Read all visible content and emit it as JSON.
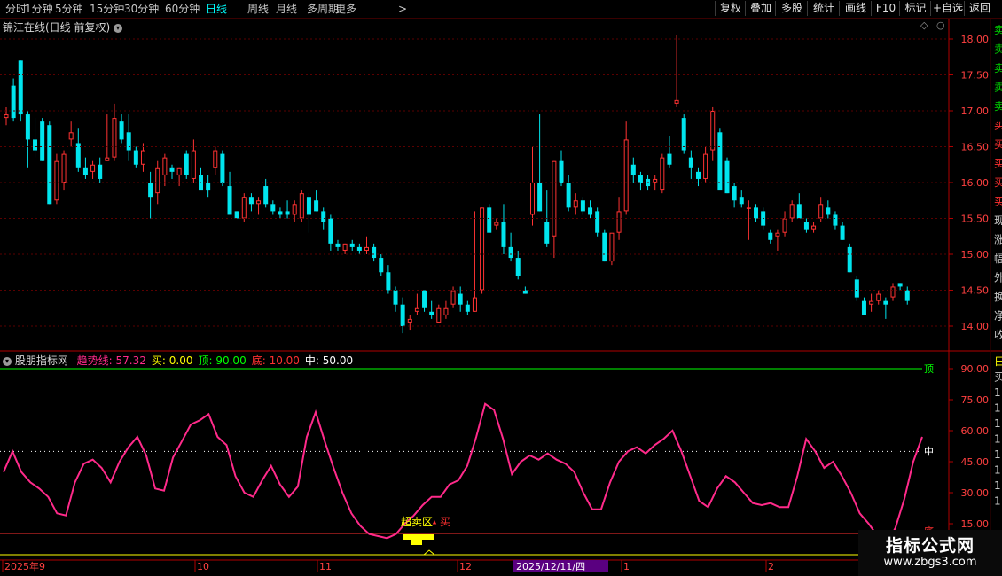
{
  "toolbar": {
    "periods": [
      {
        "label": "分时",
        "active": false
      },
      {
        "label": "1分钟",
        "active": false
      },
      {
        "label": "5分钟",
        "active": false
      },
      {
        "label": "15分钟",
        "active": false
      },
      {
        "label": "30分钟",
        "active": false
      },
      {
        "label": "60分钟",
        "active": false
      },
      {
        "label": "日线",
        "active": true
      },
      {
        "label": "周线",
        "active": false
      },
      {
        "label": "月线",
        "active": false
      },
      {
        "label": "多周期",
        "active": false
      },
      {
        "label": "更多",
        "active": false
      }
    ],
    "more_arrow": ">",
    "right_buttons": [
      "复权",
      "叠加",
      "多股",
      "统计",
      "画线",
      "F10",
      "标记",
      "+自选",
      "返回"
    ]
  },
  "price_panel": {
    "title": "锦江在线(日线 前复权)",
    "axis_ticks": [
      "18.00",
      "17.50",
      "17.00",
      "16.50",
      "16.00",
      "15.50",
      "15.00",
      "14.50",
      "14.00"
    ],
    "right_strip_chars": [
      "卖",
      "卖",
      "卖",
      "卖",
      "卖",
      "买",
      "买",
      "买",
      "买",
      "买",
      "现",
      "涨",
      "幅",
      "外",
      "换",
      "净",
      "收"
    ]
  },
  "indicator_panel": {
    "name": "股朋指标网",
    "legend": [
      {
        "label": "趋势线:",
        "value": "57.32",
        "color": "#ff2a8a"
      },
      {
        "label": "买:",
        "value": "0.00",
        "color": "#ffff00"
      },
      {
        "label": "顶:",
        "value": "90.00",
        "color": "#00ff00"
      },
      {
        "label": "底:",
        "value": "10.00",
        "color": "#ff3030"
      },
      {
        "label": "中:",
        "value": "50.00",
        "color": "#ffffff"
      }
    ],
    "axis_ticks": [
      "90.00",
      "75.00",
      "60.00",
      "45.00",
      "30.00",
      "15.00"
    ],
    "label_top": "顶",
    "label_mid": "中",
    "label_bottom": "底",
    "annotation_oversold": "超卖区",
    "annotation_buy": "买",
    "right_strip_chars": [
      "日",
      "买",
      "1",
      "1",
      "1",
      "1",
      "1",
      "1",
      "1",
      "1"
    ]
  },
  "date_axis": {
    "labels": [
      "2025年9",
      "10",
      "11",
      "12",
      "1",
      "2"
    ],
    "highlight": "2025/12/11/四"
  },
  "watermark": {
    "title": "指标公式网",
    "url": "www.zbgs3.com"
  },
  "colors": {
    "up": "#ff3232",
    "down": "#00e5ee",
    "trend": "#ff2a8a",
    "top": "#00ff00",
    "bottom": "#ff3030",
    "buy": "#ffff00",
    "mid": "#ffffff",
    "axis": "#b00000"
  },
  "chart_data": {
    "type": "candlestick",
    "price_range": [
      13.85,
      18.1
    ],
    "candles": [
      {
        "o": 16.9,
        "h": 17.05,
        "l": 16.8,
        "c": 16.95
      },
      {
        "o": 17.35,
        "h": 17.45,
        "l": 16.85,
        "c": 16.9
      },
      {
        "o": 17.7,
        "h": 17.7,
        "l": 16.85,
        "c": 16.95
      },
      {
        "o": 16.95,
        "h": 17.0,
        "l": 16.2,
        "c": 16.6
      },
      {
        "o": 16.6,
        "h": 16.9,
        "l": 16.35,
        "c": 16.45
      },
      {
        "o": 16.85,
        "h": 16.9,
        "l": 16.3,
        "c": 16.3
      },
      {
        "o": 16.8,
        "h": 16.85,
        "l": 15.7,
        "c": 15.7
      },
      {
        "o": 15.75,
        "h": 16.4,
        "l": 15.7,
        "c": 16.3
      },
      {
        "o": 16.0,
        "h": 16.45,
        "l": 15.9,
        "c": 16.4
      },
      {
        "o": 16.6,
        "h": 16.85,
        "l": 16.5,
        "c": 16.7
      },
      {
        "o": 16.55,
        "h": 16.75,
        "l": 16.15,
        "c": 16.2
      },
      {
        "o": 16.2,
        "h": 16.35,
        "l": 16.05,
        "c": 16.1
      },
      {
        "o": 16.15,
        "h": 16.3,
        "l": 16.05,
        "c": 16.25
      },
      {
        "o": 16.25,
        "h": 16.35,
        "l": 16.0,
        "c": 16.05
      },
      {
        "o": 16.3,
        "h": 16.95,
        "l": 16.3,
        "c": 16.35
      },
      {
        "o": 16.35,
        "h": 17.1,
        "l": 16.3,
        "c": 16.9
      },
      {
        "o": 16.85,
        "h": 16.95,
        "l": 16.55,
        "c": 16.6
      },
      {
        "o": 16.7,
        "h": 16.95,
        "l": 16.3,
        "c": 16.45
      },
      {
        "o": 16.45,
        "h": 16.5,
        "l": 16.2,
        "c": 16.25
      },
      {
        "o": 16.25,
        "h": 16.55,
        "l": 16.15,
        "c": 16.45
      },
      {
        "o": 16.0,
        "h": 16.15,
        "l": 15.5,
        "c": 15.8
      },
      {
        "o": 15.85,
        "h": 16.3,
        "l": 15.7,
        "c": 16.2
      },
      {
        "o": 16.1,
        "h": 16.4,
        "l": 15.95,
        "c": 16.35
      },
      {
        "o": 16.2,
        "h": 16.25,
        "l": 16.05,
        "c": 16.15
      },
      {
        "o": 16.1,
        "h": 16.2,
        "l": 15.95,
        "c": 16.2
      },
      {
        "o": 16.4,
        "h": 16.45,
        "l": 16.05,
        "c": 16.1
      },
      {
        "o": 16.05,
        "h": 16.6,
        "l": 16.0,
        "c": 16.45
      },
      {
        "o": 16.1,
        "h": 16.2,
        "l": 15.95,
        "c": 15.9
      },
      {
        "o": 16.0,
        "h": 16.1,
        "l": 15.8,
        "c": 15.9
      },
      {
        "o": 16.2,
        "h": 16.5,
        "l": 16.1,
        "c": 16.45
      },
      {
        "o": 16.4,
        "h": 16.45,
        "l": 15.95,
        "c": 16.0
      },
      {
        "o": 15.95,
        "h": 16.15,
        "l": 15.75,
        "c": 15.55
      },
      {
        "o": 15.6,
        "h": 15.6,
        "l": 15.5,
        "c": 15.5
      },
      {
        "o": 15.5,
        "h": 15.85,
        "l": 15.45,
        "c": 15.8
      },
      {
        "o": 15.8,
        "h": 15.85,
        "l": 15.6,
        "c": 15.7
      },
      {
        "o": 15.7,
        "h": 15.8,
        "l": 15.55,
        "c": 15.75
      },
      {
        "o": 15.95,
        "h": 16.05,
        "l": 15.65,
        "c": 15.7
      },
      {
        "o": 15.7,
        "h": 15.75,
        "l": 15.55,
        "c": 15.6
      },
      {
        "o": 15.6,
        "h": 15.65,
        "l": 15.5,
        "c": 15.55
      },
      {
        "o": 15.6,
        "h": 15.75,
        "l": 15.5,
        "c": 15.55
      },
      {
        "o": 15.55,
        "h": 15.75,
        "l": 15.45,
        "c": 15.7
      },
      {
        "o": 15.5,
        "h": 15.9,
        "l": 15.45,
        "c": 15.85
      },
      {
        "o": 15.8,
        "h": 15.85,
        "l": 15.3,
        "c": 15.55
      },
      {
        "o": 15.75,
        "h": 15.9,
        "l": 15.6,
        "c": 15.6
      },
      {
        "o": 15.6,
        "h": 15.65,
        "l": 15.35,
        "c": 15.45
      },
      {
        "o": 15.5,
        "h": 15.55,
        "l": 15.05,
        "c": 15.15
      },
      {
        "o": 15.15,
        "h": 15.2,
        "l": 15.05,
        "c": 15.1
      },
      {
        "o": 15.05,
        "h": 15.15,
        "l": 15.0,
        "c": 15.15
      },
      {
        "o": 15.15,
        "h": 15.2,
        "l": 15.05,
        "c": 15.1
      },
      {
        "o": 15.1,
        "h": 15.15,
        "l": 15.0,
        "c": 15.05
      },
      {
        "o": 15.05,
        "h": 15.25,
        "l": 15.0,
        "c": 15.1
      },
      {
        "o": 15.1,
        "h": 15.15,
        "l": 14.9,
        "c": 14.95
      },
      {
        "o": 14.95,
        "h": 15.0,
        "l": 14.7,
        "c": 14.75
      },
      {
        "o": 14.75,
        "h": 14.85,
        "l": 14.45,
        "c": 14.5
      },
      {
        "o": 14.5,
        "h": 14.55,
        "l": 14.2,
        "c": 14.3
      },
      {
        "o": 14.3,
        "h": 14.4,
        "l": 13.9,
        "c": 14.0
      },
      {
        "o": 14.05,
        "h": 14.15,
        "l": 13.95,
        "c": 14.1
      },
      {
        "o": 14.2,
        "h": 14.45,
        "l": 14.15,
        "c": 14.25
      },
      {
        "o": 14.5,
        "h": 14.5,
        "l": 14.2,
        "c": 14.25
      },
      {
        "o": 14.2,
        "h": 14.35,
        "l": 14.1,
        "c": 14.15
      },
      {
        "o": 14.05,
        "h": 14.3,
        "l": 14.05,
        "c": 14.25
      },
      {
        "o": 14.15,
        "h": 14.35,
        "l": 14.1,
        "c": 14.25
      },
      {
        "o": 14.3,
        "h": 14.55,
        "l": 14.25,
        "c": 14.5
      },
      {
        "o": 14.45,
        "h": 14.55,
        "l": 14.2,
        "c": 14.3
      },
      {
        "o": 14.3,
        "h": 14.35,
        "l": 14.15,
        "c": 14.2
      },
      {
        "o": 14.2,
        "h": 15.6,
        "l": 14.2,
        "c": 14.4
      },
      {
        "o": 14.5,
        "h": 15.65,
        "l": 14.45,
        "c": 15.65
      },
      {
        "o": 15.65,
        "h": 15.7,
        "l": 15.3,
        "c": 15.3
      },
      {
        "o": 15.4,
        "h": 15.5,
        "l": 15.35,
        "c": 15.45
      },
      {
        "o": 15.45,
        "h": 15.7,
        "l": 15.0,
        "c": 15.1
      },
      {
        "o": 15.1,
        "h": 15.3,
        "l": 14.9,
        "c": 14.95
      },
      {
        "o": 14.95,
        "h": 15.05,
        "l": 14.65,
        "c": 14.7
      },
      {
        "o": 14.5,
        "h": 14.55,
        "l": 14.45,
        "c": 14.45
      },
      {
        "o": 15.55,
        "h": 16.5,
        "l": 15.4,
        "c": 16.0
      },
      {
        "o": 16.0,
        "h": 16.95,
        "l": 15.6,
        "c": 15.6
      },
      {
        "o": 15.45,
        "h": 15.9,
        "l": 15.1,
        "c": 15.15
      },
      {
        "o": 15.25,
        "h": 16.3,
        "l": 14.95,
        "c": 16.3
      },
      {
        "o": 16.3,
        "h": 16.45,
        "l": 15.95,
        "c": 16.0
      },
      {
        "o": 16.0,
        "h": 16.1,
        "l": 15.6,
        "c": 15.65
      },
      {
        "o": 15.65,
        "h": 15.85,
        "l": 15.55,
        "c": 15.75
      },
      {
        "o": 15.75,
        "h": 15.8,
        "l": 15.55,
        "c": 15.6
      },
      {
        "o": 15.65,
        "h": 15.75,
        "l": 15.5,
        "c": 15.55
      },
      {
        "o": 15.6,
        "h": 15.65,
        "l": 15.25,
        "c": 15.3
      },
      {
        "o": 15.3,
        "h": 15.35,
        "l": 14.9,
        "c": 14.9
      },
      {
        "o": 14.9,
        "h": 15.1,
        "l": 14.85,
        "c": 15.3
      },
      {
        "o": 15.3,
        "h": 15.8,
        "l": 15.2,
        "c": 15.6
      },
      {
        "o": 15.6,
        "h": 16.85,
        "l": 15.55,
        "c": 16.6
      },
      {
        "o": 16.25,
        "h": 16.35,
        "l": 16.0,
        "c": 16.1
      },
      {
        "o": 16.1,
        "h": 16.15,
        "l": 15.9,
        "c": 16.0
      },
      {
        "o": 16.05,
        "h": 16.1,
        "l": 15.9,
        "c": 15.95
      },
      {
        "o": 16.0,
        "h": 16.1,
        "l": 15.9,
        "c": 16.05
      },
      {
        "o": 15.9,
        "h": 16.4,
        "l": 15.85,
        "c": 16.35
      },
      {
        "o": 16.4,
        "h": 16.65,
        "l": 16.2,
        "c": 16.25
      },
      {
        "o": 17.1,
        "h": 18.05,
        "l": 17.05,
        "c": 17.15
      },
      {
        "o": 16.9,
        "h": 16.95,
        "l": 16.4,
        "c": 16.45
      },
      {
        "o": 16.35,
        "h": 16.45,
        "l": 16.05,
        "c": 16.2
      },
      {
        "o": 16.15,
        "h": 16.2,
        "l": 15.95,
        "c": 16.05
      },
      {
        "o": 16.05,
        "h": 16.5,
        "l": 16.0,
        "c": 16.4
      },
      {
        "o": 16.45,
        "h": 17.05,
        "l": 16.3,
        "c": 17.0
      },
      {
        "o": 16.7,
        "h": 16.75,
        "l": 16.0,
        "c": 15.9
      },
      {
        "o": 16.3,
        "h": 16.35,
        "l": 15.85,
        "c": 15.85
      },
      {
        "o": 15.95,
        "h": 16.0,
        "l": 15.65,
        "c": 15.75
      },
      {
        "o": 15.8,
        "h": 15.9,
        "l": 15.65,
        "c": 15.7
      },
      {
        "o": 15.65,
        "h": 15.75,
        "l": 15.2,
        "c": 15.65
      },
      {
        "o": 15.65,
        "h": 15.7,
        "l": 15.45,
        "c": 15.5
      },
      {
        "o": 15.6,
        "h": 15.65,
        "l": 15.35,
        "c": 15.4
      },
      {
        "o": 15.3,
        "h": 15.35,
        "l": 15.15,
        "c": 15.2
      },
      {
        "o": 15.25,
        "h": 15.35,
        "l": 15.05,
        "c": 15.3
      },
      {
        "o": 15.3,
        "h": 15.6,
        "l": 15.25,
        "c": 15.5
      },
      {
        "o": 15.5,
        "h": 15.75,
        "l": 15.45,
        "c": 15.7
      },
      {
        "o": 15.7,
        "h": 15.85,
        "l": 15.5,
        "c": 15.5
      },
      {
        "o": 15.45,
        "h": 15.5,
        "l": 15.3,
        "c": 15.35
      },
      {
        "o": 15.35,
        "h": 15.45,
        "l": 15.3,
        "c": 15.4
      },
      {
        "o": 15.5,
        "h": 15.8,
        "l": 15.45,
        "c": 15.7
      },
      {
        "o": 15.65,
        "h": 15.75,
        "l": 15.5,
        "c": 15.55
      },
      {
        "o": 15.55,
        "h": 15.6,
        "l": 15.35,
        "c": 15.4
      },
      {
        "o": 15.4,
        "h": 15.45,
        "l": 15.2,
        "c": 15.2
      },
      {
        "o": 15.1,
        "h": 15.15,
        "l": 14.75,
        "c": 14.75
      },
      {
        "o": 14.65,
        "h": 14.7,
        "l": 14.35,
        "c": 14.4
      },
      {
        "o": 14.35,
        "h": 14.4,
        "l": 14.15,
        "c": 14.15
      },
      {
        "o": 14.3,
        "h": 14.45,
        "l": 14.2,
        "c": 14.35
      },
      {
        "o": 14.35,
        "h": 14.5,
        "l": 14.3,
        "c": 14.45
      },
      {
        "o": 14.35,
        "h": 14.4,
        "l": 14.1,
        "c": 14.3
      },
      {
        "o": 14.4,
        "h": 14.6,
        "l": 14.35,
        "c": 14.55
      },
      {
        "o": 14.6,
        "h": 14.6,
        "l": 14.5,
        "c": 14.55
      },
      {
        "o": 14.5,
        "h": 14.55,
        "l": 14.3,
        "c": 14.35
      }
    ],
    "trend_line": [
      40,
      50,
      40,
      35,
      32,
      28,
      20,
      19,
      35,
      44,
      46,
      42,
      35,
      45,
      52,
      57,
      48,
      32,
      31,
      47,
      55,
      63,
      65,
      68,
      57,
      53,
      38,
      30,
      28,
      36,
      43,
      34,
      28,
      33,
      57,
      69,
      55,
      42,
      30,
      20,
      14,
      10,
      9,
      8,
      10,
      15,
      19,
      24,
      28,
      28,
      34,
      36,
      43,
      57,
      73,
      70,
      56,
      39,
      45,
      48,
      46,
      49,
      46,
      44,
      40,
      30,
      22,
      22,
      35,
      45,
      50,
      52,
      49,
      53,
      56,
      60,
      50,
      38,
      26,
      23,
      32,
      38,
      35,
      30,
      25,
      24,
      25,
      23,
      23,
      38,
      56,
      50,
      42,
      45,
      38,
      30,
      20,
      15,
      9,
      5,
      13,
      27,
      45,
      57
    ]
  }
}
